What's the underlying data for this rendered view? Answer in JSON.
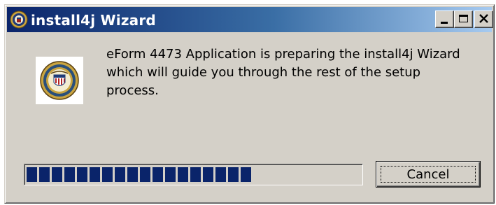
{
  "window": {
    "title": "install4j Wizard",
    "controls": {
      "minimize_icon": "minimize-icon",
      "maximize_icon": "maximize-icon",
      "close_icon": "close-icon"
    }
  },
  "content": {
    "logo_icon": "agency-seal-icon",
    "message": "eForm 4473 Application is preparing the install4j Wizard which will guide you through the rest of the setup process."
  },
  "progress": {
    "fraction": 0.68,
    "color": "#0a246a"
  },
  "buttons": {
    "cancel_label": "Cancel"
  },
  "colors": {
    "titlebar_start": "#0a246a",
    "titlebar_end": "#a6caf0",
    "dialog_face": "#d4d0c8"
  }
}
